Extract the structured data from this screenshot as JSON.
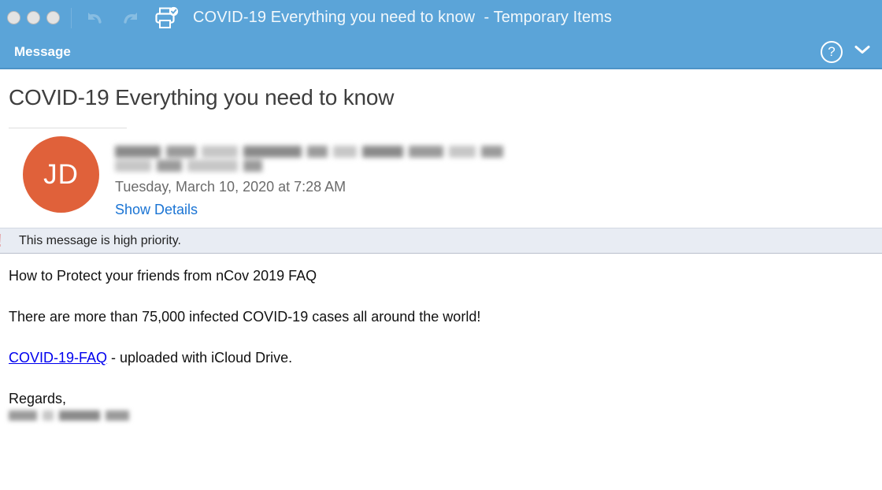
{
  "window": {
    "title": "COVID-19 Everything you need to know  - Temporary Items",
    "traffic_lights": [
      "close",
      "minimize",
      "maximize"
    ],
    "toolbar_icons": [
      "undo-icon",
      "redo-icon",
      "print-icon"
    ]
  },
  "ribbon": {
    "tab_label": "Message",
    "help_label": "?",
    "chevron_label": "chevron-down-icon"
  },
  "message": {
    "subject": "COVID-19 Everything you need to know",
    "avatar_initials": "JD",
    "sender_redacted": true,
    "date": "Tuesday, March 10, 2020 at 7:28 AM",
    "show_details_label": "Show Details",
    "priority_notice": "This message is high priority."
  },
  "body": {
    "paragraph_1": "How to Protect your friends from nCov 2019 FAQ",
    "paragraph_2": "There are more than 75,000 infected COVID-19 cases all around the world!",
    "link_text": "COVID-19-FAQ",
    "link_suffix": " - uploaded with iCloud Drive.",
    "signoff": "Regards,",
    "signature_redacted": true
  },
  "colors": {
    "titlebar_blue": "#5ba4d8",
    "avatar_orange": "#e0613a",
    "link_blue": "#0000ee",
    "details_blue": "#1a74d4",
    "banner_bg": "#e8ecf3",
    "priority_red": "#e05252"
  }
}
